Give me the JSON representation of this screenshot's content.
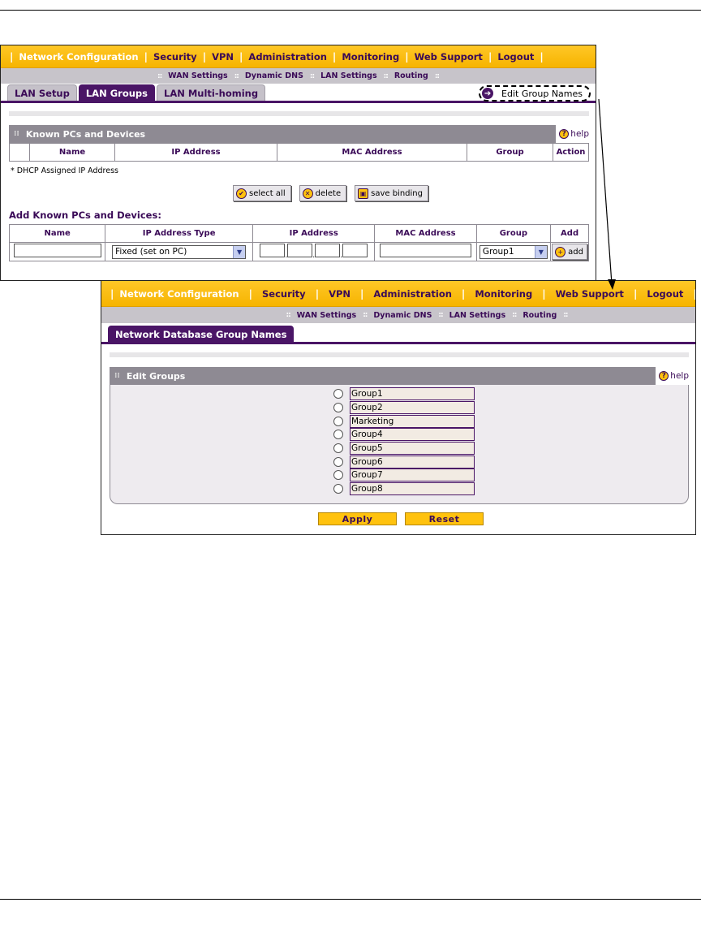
{
  "top_nav": [
    "Network Configuration",
    "Security",
    "VPN",
    "Administration",
    "Monitoring",
    "Web Support",
    "Logout"
  ],
  "sub_nav": [
    "WAN Settings",
    "Dynamic DNS",
    "LAN Settings",
    "Routing"
  ],
  "screen1": {
    "tabs": [
      "LAN Setup",
      "LAN Groups",
      "LAN Multi-homing"
    ],
    "active_tab": "LAN Groups",
    "edit_group_names": "Edit Group Names",
    "known_section": {
      "title": "Known PCs and Devices",
      "help": "help",
      "columns": [
        "Name",
        "IP Address",
        "MAC Address",
        "Group",
        "Action"
      ]
    },
    "dhcp_note": "* DHCP Assigned IP Address",
    "buttons": {
      "select_all": "select all",
      "delete": "delete",
      "save_binding": "save binding"
    },
    "add_section": {
      "title": "Add Known PCs and Devices:",
      "columns": [
        "Name",
        "IP Address Type",
        "IP Address",
        "MAC Address",
        "Group",
        "Add"
      ],
      "name_value": "",
      "ip_type_value": "Fixed (set on PC)",
      "ip_octets": [
        "",
        "",
        "",
        ""
      ],
      "mac_value": "",
      "group_value": "Group1",
      "add_label": "add"
    }
  },
  "screen2": {
    "tab": "Network Database Group Names",
    "section_title": "Edit Groups",
    "help": "help",
    "groups": [
      "Group1",
      "Group2",
      "Marketing",
      "Group4",
      "Group5",
      "Group6",
      "Group7",
      "Group8"
    ],
    "apply_label": "Apply",
    "reset_label": "Reset"
  },
  "colors": {
    "nav_yellow": "#ffc20e",
    "purple": "#4a1566",
    "grey_header": "#8e8a93"
  }
}
